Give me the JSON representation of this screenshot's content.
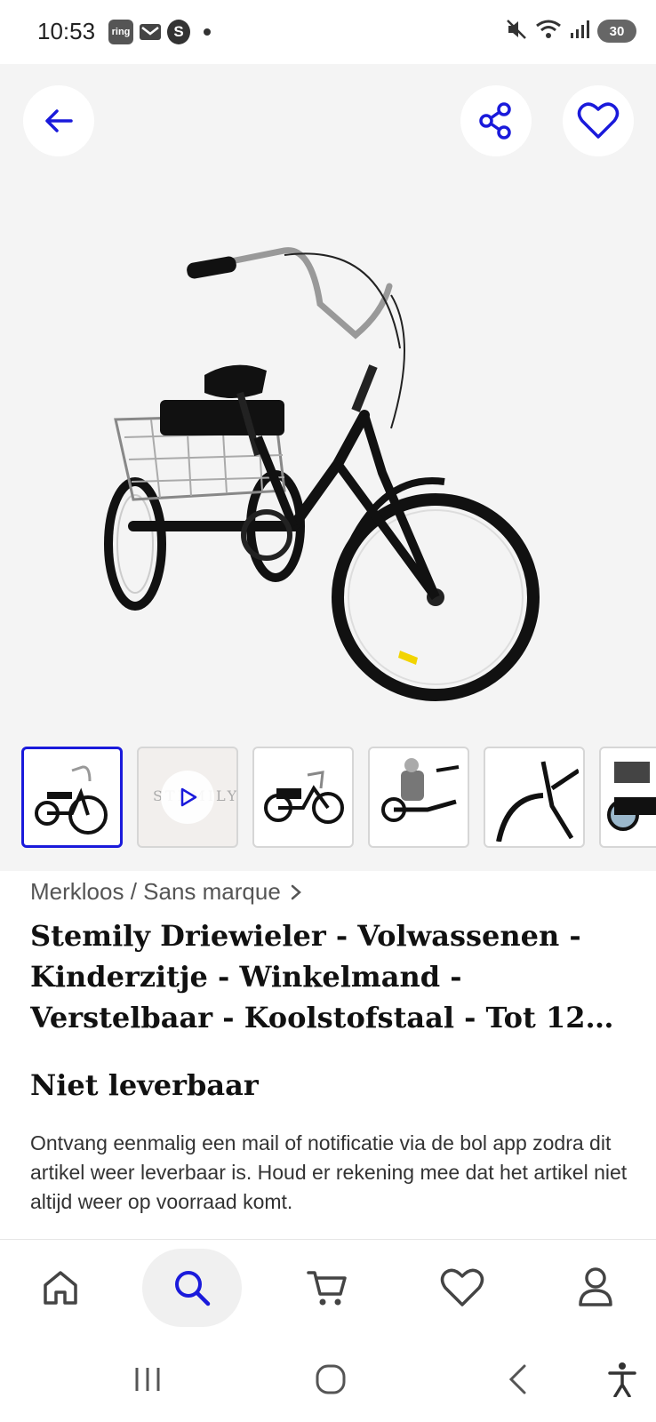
{
  "status_bar": {
    "time": "10:53",
    "notification_ring": "ring",
    "notification_s": "S",
    "battery": "30"
  },
  "header": {
    "back_icon": "arrow-left-icon",
    "share_icon": "share-icon",
    "favorite_icon": "heart-icon"
  },
  "gallery": {
    "video_thumb_text": "STEMILY",
    "thumbnail_count": 6,
    "selected_index": 0
  },
  "product": {
    "brand_link": "Merkloos / Sans marque",
    "title": "Stemily Driewieler - Volwassenen - Kinderzitje - Winkelmand - Verstelbaar - Koolstofstaal - Tot 12…",
    "availability": "Niet leverbaar",
    "notice": "Ontvang eenmalig een mail of notificatie via de bol app zodra dit artikel weer leverbaar is. Houd er rekening mee dat het artikel niet altijd weer op voorraad komt."
  },
  "bottom_nav": {
    "items": [
      "home-icon",
      "search-icon",
      "cart-icon",
      "heart-icon",
      "profile-icon"
    ],
    "active": "search-icon"
  },
  "colors": {
    "accent": "#1a1adb",
    "hero_bg": "#f4f4f4"
  }
}
